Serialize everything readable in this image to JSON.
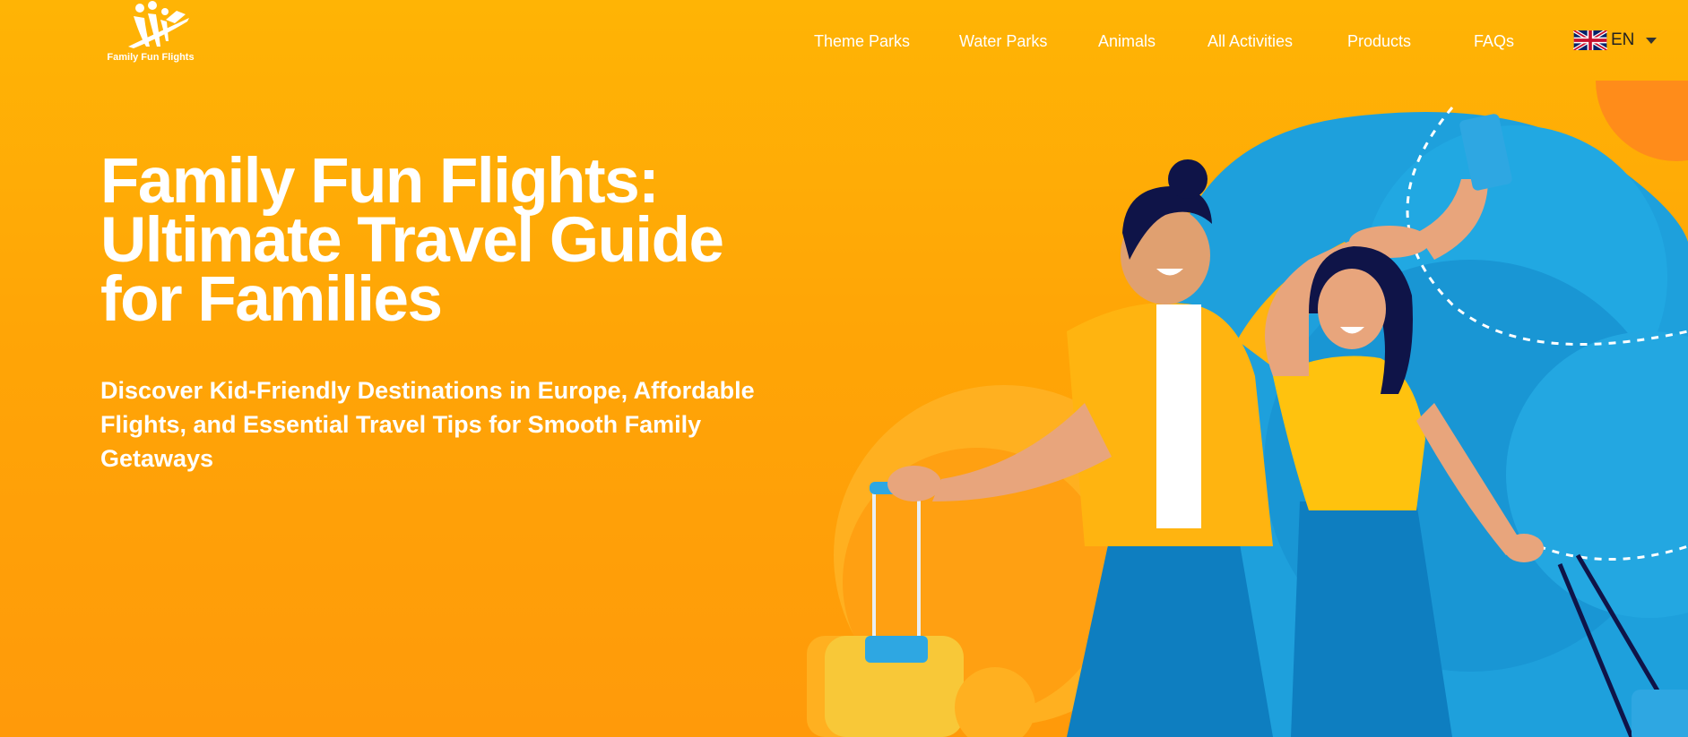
{
  "brand": {
    "name": "Family Fun Flights"
  },
  "nav": {
    "items": [
      {
        "label": "Theme Parks"
      },
      {
        "label": "Water Parks"
      },
      {
        "label": "Animals"
      },
      {
        "label": "All Activities"
      },
      {
        "label": "Products"
      },
      {
        "label": "FAQs"
      }
    ],
    "language": {
      "code": "EN",
      "flag": "uk-flag-icon"
    }
  },
  "hero": {
    "title": "Family Fun Flights: Ultimate Travel Guide for Families",
    "subtitle": "Discover Kid-Friendly Destinations in Europe, Affordable Flights, and Essential Travel Tips for Smooth Family Getaways"
  },
  "colors": {
    "background_top": "#FFB405",
    "background_bottom": "#FF9A0A",
    "accent_blue": "#1EA0DC",
    "text": "#FFFFFF"
  }
}
